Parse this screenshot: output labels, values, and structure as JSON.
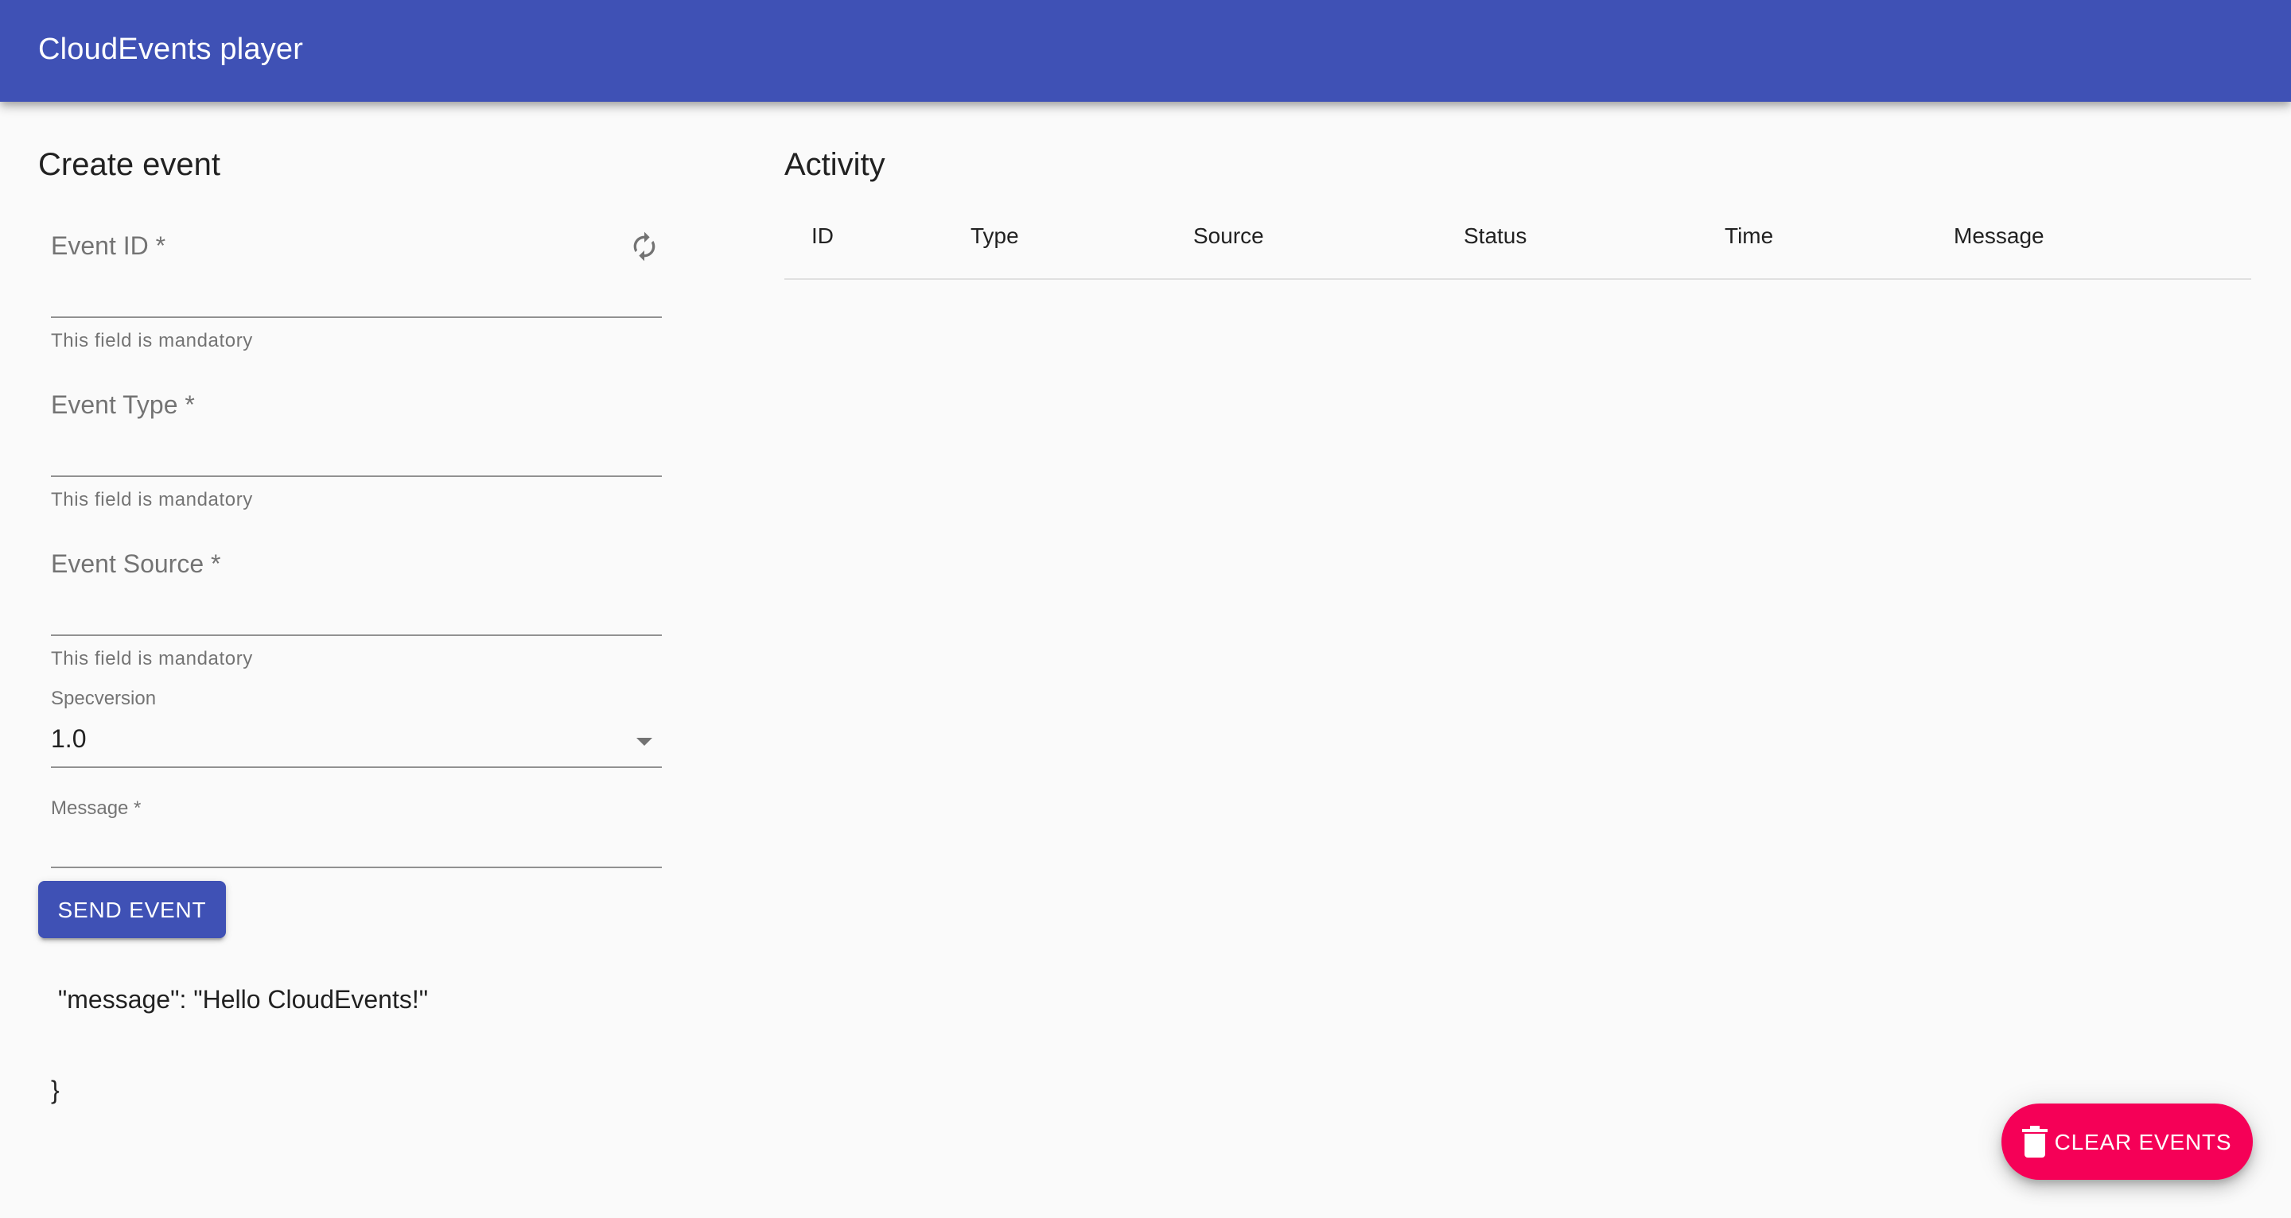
{
  "app": {
    "title": "CloudEvents player",
    "colors": {
      "primary": "#3f51b5",
      "secondary": "#f50057",
      "background": "#fafafa"
    }
  },
  "create_event": {
    "title": "Create event",
    "fields": {
      "event_id": {
        "placeholder": "Event ID *",
        "value": "",
        "helper": "This field is mandatory",
        "icon": "refresh-icon"
      },
      "event_type": {
        "placeholder": "Event Type *",
        "value": "",
        "helper": "This field is mandatory"
      },
      "event_source": {
        "placeholder": "Event Source *",
        "value": "",
        "helper": "This field is mandatory"
      },
      "specversion": {
        "label": "Specversion",
        "value": "1.0",
        "icon": "dropdown-arrow-icon"
      },
      "message": {
        "label": "Message *",
        "lines": [
          "{",
          " \"message\": \"Hello CloudEvents!\"",
          "}"
        ]
      }
    },
    "send_button": "SEND EVENT"
  },
  "activity": {
    "title": "Activity",
    "columns": [
      "ID",
      "Type",
      "Source",
      "Status",
      "Time",
      "Message"
    ],
    "rows": []
  },
  "clear_button": {
    "label": "CLEAR EVENTS",
    "icon": "trash-icon"
  }
}
